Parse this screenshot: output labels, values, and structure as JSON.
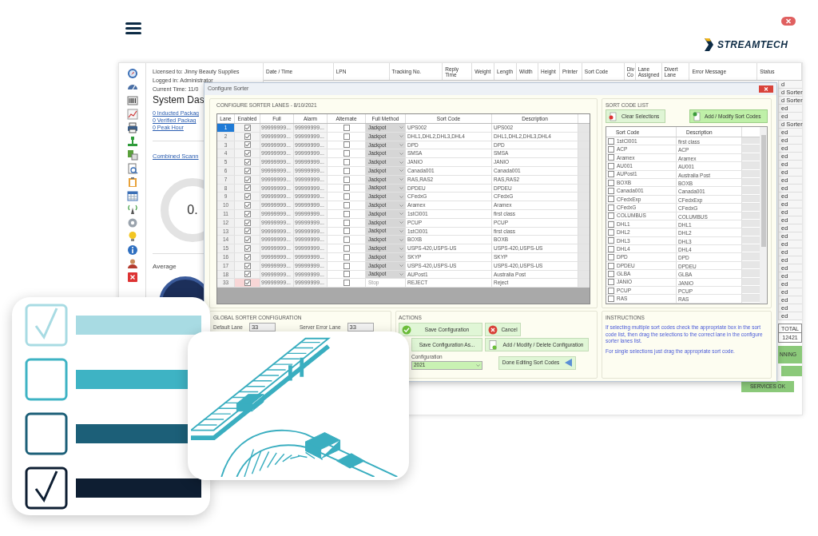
{
  "logo": {
    "text": "STREAMTECH"
  },
  "app": {
    "license": "Licensed to: Jinny Beauty Supplies",
    "logged_in": "Logged in: Administrator",
    "current_time": "Current Time: 11/0",
    "dashboard_title": "System Das",
    "links": [
      "0 Inducted Packag",
      "0 Verified Packag",
      "0 Peak Hour"
    ],
    "scanner_link": "Combined Scann",
    "gauge_value": "0.",
    "average_label": "Average",
    "columns": [
      "Date / Time",
      "LPN",
      "Tracking No.",
      "Reply Time",
      "Weight",
      "Length",
      "Width",
      "Height",
      "Printer",
      "Sort Code",
      "Div Co",
      "Lane Assigned",
      "Divert Lane",
      "Error Message",
      "Status"
    ],
    "status_cells": [
      "d",
      "d Sorter",
      "d Sorter",
      "ed",
      "ed",
      "d Sorter",
      "ed",
      "ed",
      "ed",
      "ed",
      "ed",
      "ed",
      "ed",
      "ed",
      "ed",
      "ed",
      "ed",
      "ed",
      "ed",
      "ed",
      "ed",
      "ed",
      "ed",
      "ed",
      "ed",
      "ed",
      "ed",
      "ed",
      "ed",
      "ed"
    ],
    "total_label": "TOTAL",
    "total_value": "12421",
    "running_button": "NNING",
    "services_button": "SERVICES OK"
  },
  "dialog": {
    "title": "Configure Sorter",
    "lanes_title": "CONFIGURE SORTER LANES - 8/10/2021",
    "lane_columns": [
      "Lane",
      "Enabled",
      "Full",
      "Alarm",
      "Alternate",
      "Full Method",
      "Sort Code",
      "Description"
    ],
    "lanes": [
      {
        "lane": "1",
        "selected": true,
        "enabled": true,
        "highlighted": false,
        "full": "99999999...",
        "alarm": "99999999...",
        "alternate": false,
        "method": "Jackpot",
        "method_disabled": false,
        "sort_code": "UPS002",
        "description": "UPS002"
      },
      {
        "lane": "2",
        "selected": false,
        "enabled": true,
        "highlighted": false,
        "full": "99999999...",
        "alarm": "99999999...",
        "alternate": false,
        "method": "Jackpot",
        "method_disabled": false,
        "sort_code": "DHL1,DHL2,DHL3,DHL4",
        "description": "DHL1,DHL2,DHL3,DHL4"
      },
      {
        "lane": "3",
        "selected": false,
        "enabled": true,
        "highlighted": false,
        "full": "99999999...",
        "alarm": "99999999...",
        "alternate": false,
        "method": "Jackpot",
        "method_disabled": false,
        "sort_code": "DPD",
        "description": "DPD"
      },
      {
        "lane": "4",
        "selected": false,
        "enabled": true,
        "highlighted": false,
        "full": "99999999...",
        "alarm": "99999999...",
        "alternate": false,
        "method": "Jackpot",
        "method_disabled": false,
        "sort_code": "SMSA",
        "description": "SMSA"
      },
      {
        "lane": "5",
        "selected": false,
        "enabled": true,
        "highlighted": false,
        "full": "99999999...",
        "alarm": "99999999...",
        "alternate": false,
        "method": "Jackpot",
        "method_disabled": false,
        "sort_code": "JANIO",
        "description": "JANIO"
      },
      {
        "lane": "6",
        "selected": false,
        "enabled": true,
        "highlighted": false,
        "full": "99999999...",
        "alarm": "99999999...",
        "alternate": false,
        "method": "Jackpot",
        "method_disabled": false,
        "sort_code": "Canada001",
        "description": "Canada001"
      },
      {
        "lane": "7",
        "selected": false,
        "enabled": true,
        "highlighted": false,
        "full": "99999999...",
        "alarm": "99999999...",
        "alternate": false,
        "method": "Jackpot",
        "method_disabled": false,
        "sort_code": "RAS,RAS2",
        "description": "RAS,RAS2"
      },
      {
        "lane": "8",
        "selected": false,
        "enabled": true,
        "highlighted": false,
        "full": "99999999...",
        "alarm": "99999999...",
        "alternate": false,
        "method": "Jackpot",
        "method_disabled": false,
        "sort_code": "DPDEU",
        "description": "DPDEU"
      },
      {
        "lane": "9",
        "selected": false,
        "enabled": true,
        "highlighted": false,
        "full": "99999999...",
        "alarm": "99999999...",
        "alternate": false,
        "method": "Jackpot",
        "method_disabled": false,
        "sort_code": "CFedxG",
        "description": "CFedxG"
      },
      {
        "lane": "10",
        "selected": false,
        "enabled": true,
        "highlighted": false,
        "full": "99999999...",
        "alarm": "99999999...",
        "alternate": false,
        "method": "Jackpot",
        "method_disabled": false,
        "sort_code": "Aramex",
        "description": "Aramex"
      },
      {
        "lane": "11",
        "selected": false,
        "enabled": true,
        "highlighted": false,
        "full": "99999999...",
        "alarm": "99999999...",
        "alternate": false,
        "method": "Jackpot",
        "method_disabled": false,
        "sort_code": "1stCl001",
        "description": "first class"
      },
      {
        "lane": "12",
        "selected": false,
        "enabled": true,
        "highlighted": false,
        "full": "99999999...",
        "alarm": "99999999...",
        "alternate": false,
        "method": "Jackpot",
        "method_disabled": false,
        "sort_code": "PCUP",
        "description": "PCUP"
      },
      {
        "lane": "13",
        "selected": false,
        "enabled": true,
        "highlighted": false,
        "full": "99999999...",
        "alarm": "99999999...",
        "alternate": false,
        "method": "Jackpot",
        "method_disabled": false,
        "sort_code": "1stCl001",
        "description": "first class"
      },
      {
        "lane": "14",
        "selected": false,
        "enabled": true,
        "highlighted": false,
        "full": "99999999...",
        "alarm": "99999999...",
        "alternate": false,
        "method": "Jackpot",
        "method_disabled": false,
        "sort_code": "BOXB",
        "description": "BOXB"
      },
      {
        "lane": "15",
        "selected": false,
        "enabled": true,
        "highlighted": false,
        "full": "99999999...",
        "alarm": "99999999...",
        "alternate": false,
        "method": "Jackpot",
        "method_disabled": false,
        "sort_code": "USPS-420,USPS-US",
        "description": "USPS-420,USPS-US"
      },
      {
        "lane": "16",
        "selected": false,
        "enabled": true,
        "highlighted": false,
        "full": "99999999...",
        "alarm": "99999999...",
        "alternate": false,
        "method": "Jackpot",
        "method_disabled": false,
        "sort_code": "SKYP",
        "description": "SKYP"
      },
      {
        "lane": "17",
        "selected": false,
        "enabled": true,
        "highlighted": false,
        "full": "99999999...",
        "alarm": "99999999...",
        "alternate": false,
        "method": "Jackpot",
        "method_disabled": false,
        "sort_code": "USPS-420,USPS-US",
        "description": "USPS-420,USPS-US"
      },
      {
        "lane": "18",
        "selected": false,
        "enabled": true,
        "highlighted": false,
        "full": "99999999...",
        "alarm": "99999999...",
        "alternate": false,
        "method": "Jackpot",
        "method_disabled": false,
        "sort_code": "AUPost1",
        "description": "Australia Post"
      },
      {
        "lane": "33",
        "selected": false,
        "enabled": true,
        "highlighted": true,
        "full": "99999999...",
        "alarm": "99999999...",
        "alternate": false,
        "method": "Stop",
        "method_disabled": true,
        "sort_code": "REJECT",
        "description": "Reject"
      }
    ],
    "sort_list_title": "SORT CODE LIST",
    "clear_button": "Clear Selections",
    "add_button": "Add / Modify Sort Codes",
    "sort_columns": [
      "Sort Code",
      "Description"
    ],
    "sort_codes": [
      {
        "code": "1stCl001",
        "description": "first class",
        "checked": false
      },
      {
        "code": "ACP",
        "description": "ACP",
        "checked": false
      },
      {
        "code": "Aramex",
        "description": "Aramex",
        "checked": false
      },
      {
        "code": "AU001",
        "description": "AU001",
        "checked": false
      },
      {
        "code": "AUPost1",
        "description": "Australia Post",
        "checked": false
      },
      {
        "code": "BOXB",
        "description": "BOXB",
        "checked": false
      },
      {
        "code": "Canada001",
        "description": "Canada001",
        "checked": false
      },
      {
        "code": "CFedxExp",
        "description": "CFedxExp",
        "checked": false
      },
      {
        "code": "CFedxG",
        "description": "CFedxG",
        "checked": false
      },
      {
        "code": "COLUMBUS",
        "description": "COLUMBUS",
        "checked": false
      },
      {
        "code": "DHL1",
        "description": "DHL1",
        "checked": false
      },
      {
        "code": "DHL2",
        "description": "DHL2",
        "checked": false
      },
      {
        "code": "DHL3",
        "description": "DHL3",
        "checked": false
      },
      {
        "code": "DHL4",
        "description": "DHL4",
        "checked": false
      },
      {
        "code": "DPD",
        "description": "DPD",
        "checked": false
      },
      {
        "code": "DPDEU",
        "description": "DPDEU",
        "checked": false
      },
      {
        "code": "GLBA",
        "description": "GLBA",
        "checked": false
      },
      {
        "code": "JANIO",
        "description": "JANIO",
        "checked": false
      },
      {
        "code": "PCUP",
        "description": "PCUP",
        "checked": false
      },
      {
        "code": "RAS",
        "description": "RAS",
        "checked": false
      }
    ],
    "global_title": "GLOBAL SORTER CONFIGURATION",
    "default_lane_label": "Default Lane",
    "default_lane": "33",
    "server_error_label": "Server Error Lane",
    "server_error_lane": "33",
    "actions_title": "ACTIONS",
    "actions": [
      {
        "kind": "save",
        "label": "Save Configuration"
      },
      {
        "kind": "cancel",
        "label": "Cancel"
      },
      {
        "kind": "save_as",
        "label": "Save Configuration As..."
      },
      {
        "kind": "edit",
        "label": "Add / Modify / Delete Configuration"
      },
      {
        "kind": "done",
        "label": "Done Editing Sort Codes"
      }
    ],
    "configuration_label": "Configuration",
    "configuration_value": "2021",
    "instructions_title": "INSTRUCTIONS",
    "instructions": [
      "If selecting multiple sort codes check the appropriate box in the sort code list, then drag the selections to the correct lane in the configure sorter lanes list.",
      "For single selections just drag the appropriate sort code."
    ]
  },
  "checklist": [
    {
      "checked": true
    },
    {
      "checked": false
    },
    {
      "checked": false
    },
    {
      "checked": true
    }
  ]
}
